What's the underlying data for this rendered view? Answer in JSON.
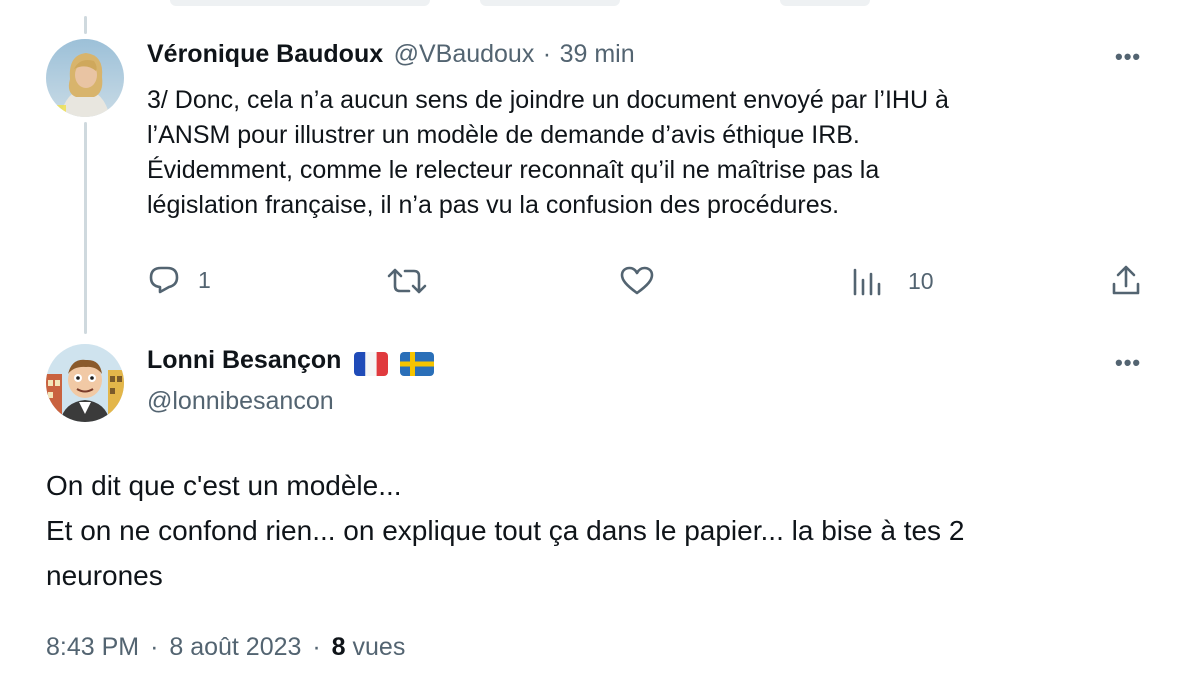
{
  "tweet1": {
    "author_name": "Véronique Baudoux",
    "handle": "@VBaudoux",
    "separator": "·",
    "time": "39 min",
    "more_label": "•••",
    "text": "3/ Donc, cela n’a aucun sens de joindre un document envoyé par l’IHU à\nl’ANSM pour illustrer un modèle de demande d’avis éthique IRB.\nÉvidemment, comme le relecteur reconnaît qu’il ne maîtrise pas la\nlégislation française, il n’a pas vu la confusion des procédures.",
    "actions": {
      "reply_icon": "reply-icon",
      "reply_count": "1",
      "retweet_icon": "retweet-icon",
      "like_icon": "heart-icon",
      "views_icon": "views-icon",
      "views_count": "10",
      "share_icon": "share-icon"
    }
  },
  "tweet2": {
    "author_name": "Lonni Besançon",
    "flags": [
      "flag-france",
      "flag-sweden"
    ],
    "handle": "@lonnibesancon",
    "more_label": "•••",
    "text": "On dit que c'est un modèle...\nEt on ne confond rien... on explique tout ça dans le papier... la bise à tes 2\nneurones",
    "meta": {
      "time": "8:43 PM",
      "separator1": "·",
      "date": "8 août 2023",
      "separator2": "·",
      "views_count": "8",
      "views_label": "vues"
    }
  },
  "colors": {
    "text": "#0f1419",
    "muted": "#536471",
    "thread_line": "#cfd9de"
  }
}
